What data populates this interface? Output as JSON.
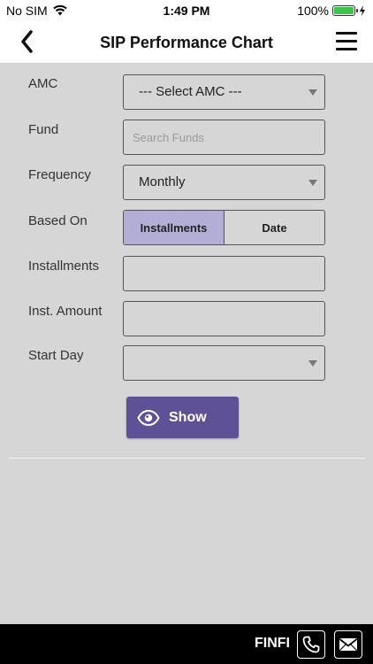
{
  "status": {
    "carrier": "No SIM",
    "time": "1:49 PM",
    "battery": "100%",
    "battery_level": 1.0,
    "battery_color": "#3bc44b"
  },
  "nav": {
    "title": "SIP Performance Chart",
    "back_icon": "chevron-left-icon",
    "menu_icon": "hamburger-menu-icon"
  },
  "form": {
    "amc": {
      "label": "AMC",
      "value": "--- Select AMC ---"
    },
    "fund": {
      "label": "Fund",
      "placeholder": "Search Funds",
      "value": ""
    },
    "frequency": {
      "label": "Frequency",
      "value": "Monthly"
    },
    "based_on": {
      "label": "Based On",
      "options": [
        "Installments",
        "Date"
      ],
      "selected": "Installments"
    },
    "installments": {
      "label": "Installments",
      "value": ""
    },
    "inst_amount": {
      "label": "Inst. Amount",
      "value": ""
    },
    "start_day": {
      "label": "Start Day",
      "value": ""
    },
    "show_button": {
      "label": "Show",
      "icon": "eye-icon"
    }
  },
  "footer": {
    "brand": "FINFI",
    "phone_icon": "phone-icon",
    "mail_icon": "mail-icon"
  },
  "colors": {
    "accent": "#5e5196",
    "segment_active": "#b3aed6",
    "background": "#d6d6d6"
  }
}
